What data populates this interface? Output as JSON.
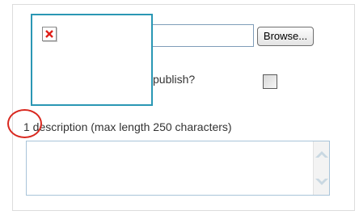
{
  "upload": {
    "file_value": "",
    "browse_label": "Browse..."
  },
  "image_preview": {
    "icon": "broken-image-icon"
  },
  "publish": {
    "label": "publish?",
    "checked": false
  },
  "description": {
    "label": "1 description (max length 250 characters)",
    "value": ""
  },
  "scrollbar": {
    "up_icon": "chevron-up-icon",
    "down_icon": "chevron-down-icon"
  },
  "colors": {
    "image_border": "#2a97b4",
    "highlight_circle": "#d9281f",
    "broken_x": "#e0201a"
  }
}
